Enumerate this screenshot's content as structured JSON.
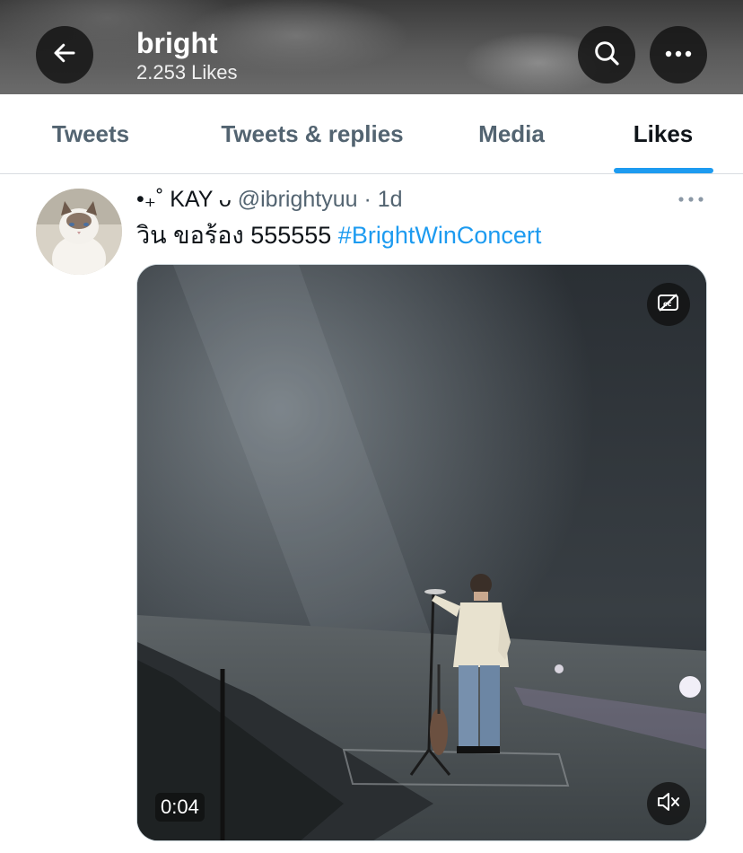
{
  "header": {
    "title": "bright",
    "subtitle": "2.253 Likes",
    "back_icon": "arrow-left-icon",
    "search_icon": "search-icon",
    "more_icon": "more-horizontal-icon"
  },
  "tabs": [
    {
      "label": "Tweets",
      "active": false
    },
    {
      "label": "Tweets & replies",
      "active": false
    },
    {
      "label": "Media",
      "active": false
    },
    {
      "label": "Likes",
      "active": true
    }
  ],
  "tweet": {
    "display_name": "•₊˚ KAY ᴗ",
    "handle": "@ibrightyuu",
    "separator": "·",
    "time": "1d",
    "text": "วิน ขอร้อง 555555 ",
    "hashtag": "#BrightWinConcert",
    "media": {
      "duration": "0:04",
      "captions_icon": "captions-off-icon",
      "volume_icon": "volume-muted-icon"
    }
  },
  "colors": {
    "accent": "#1d9bf0",
    "text_primary": "#0f1419",
    "text_secondary": "#536471"
  }
}
